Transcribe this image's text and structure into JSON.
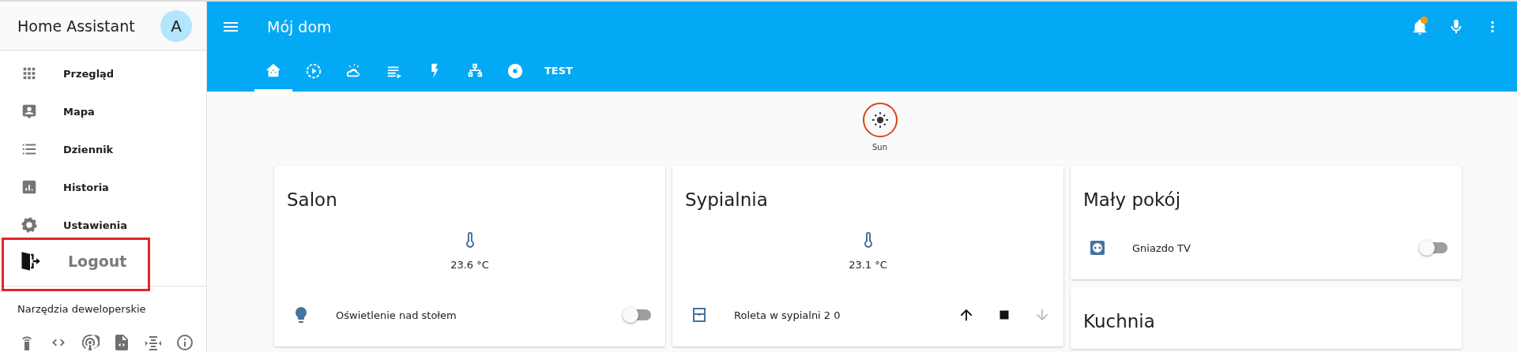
{
  "sidebar": {
    "title": "Home Assistant",
    "avatar": "A",
    "items": [
      {
        "label": "Przegląd",
        "annotated": false
      },
      {
        "label": "Mapa",
        "annotated": false
      },
      {
        "label": "Dziennik",
        "annotated": false
      },
      {
        "label": "Historia",
        "annotated": false
      },
      {
        "label": "Ustawienia",
        "annotated": false
      },
      {
        "label": "Logout",
        "annotated": true
      }
    ],
    "dev_tools_title": "Narzędzia deweloperskie"
  },
  "header": {
    "title": "Mój dom",
    "notification_badge": true,
    "tabs": [
      {
        "selected": true
      },
      {
        "selected": false
      },
      {
        "selected": false
      },
      {
        "selected": false
      },
      {
        "selected": false
      },
      {
        "selected": false
      },
      {
        "selected": false
      },
      {
        "label": "TEST",
        "selected": false
      }
    ]
  },
  "badges": [
    {
      "label": "Sun"
    }
  ],
  "columns": [
    [
      {
        "title": "Salon",
        "sensors": [
          {
            "value": "23.6 °C"
          }
        ],
        "entities": [
          {
            "kind": "toggle",
            "name": "Oświetlenie nad stołem",
            "on": false
          }
        ]
      }
    ],
    [
      {
        "title": "Sypialnia",
        "sensors": [
          {
            "value": "23.1 °C"
          }
        ],
        "entities": [
          {
            "kind": "cover",
            "name": "Roleta w sypialni 2 0",
            "down_disabled": true
          }
        ]
      }
    ],
    [
      {
        "title": "Mały pokój",
        "entities": [
          {
            "kind": "toggle",
            "name": "Gniazdo TV",
            "on": false
          }
        ]
      },
      {
        "title": "Kuchnia"
      }
    ]
  ]
}
